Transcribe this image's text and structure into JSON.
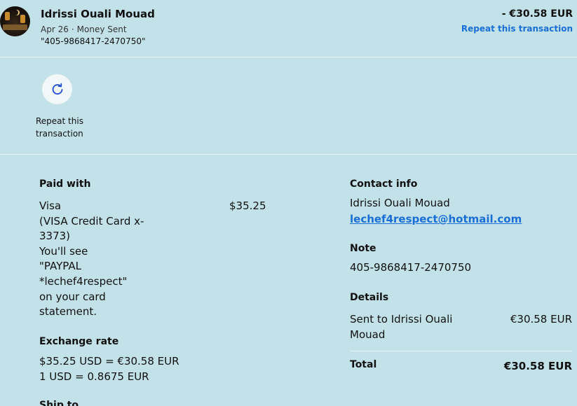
{
  "header": {
    "name": "Idrissi Ouali Mouad",
    "date": "Apr 26",
    "type": "Money Sent",
    "memo": "\"405-9868417-2470750\"",
    "amount": "- €30.58 EUR",
    "repeat_link": "Repeat this transaction"
  },
  "actions": {
    "repeat_label": "Repeat this transaction",
    "repeat_icon": "refresh-icon"
  },
  "paid_with": {
    "heading": "Paid with",
    "lines": [
      "Visa",
      "(VISA Credit Card x-",
      "3373)",
      "You'll see",
      "\"PAYPAL",
      "*lechef4respect\"",
      "on your card",
      "statement."
    ],
    "amount": "$35.25"
  },
  "exchange_rate": {
    "heading": "Exchange rate",
    "line1": "$35.25 USD = €30.58 EUR",
    "line2": "1 USD = 0.8675 EUR"
  },
  "ship_to": {
    "heading": "Ship to"
  },
  "contact": {
    "heading": "Contact info",
    "name": "Idrissi Ouali Mouad",
    "email": "lechef4respect@hotmail.com"
  },
  "note": {
    "heading": "Note",
    "text": "405-9868417-2470750"
  },
  "details": {
    "heading": "Details",
    "desc_line1": "Sent to Idrissi Ouali",
    "desc_line2": "Mouad",
    "amount": "€30.58 EUR",
    "total_label": "Total",
    "total_amount": "€30.58 EUR"
  },
  "colors": {
    "background": "#c2e1e8",
    "link": "#1a6fd6"
  }
}
